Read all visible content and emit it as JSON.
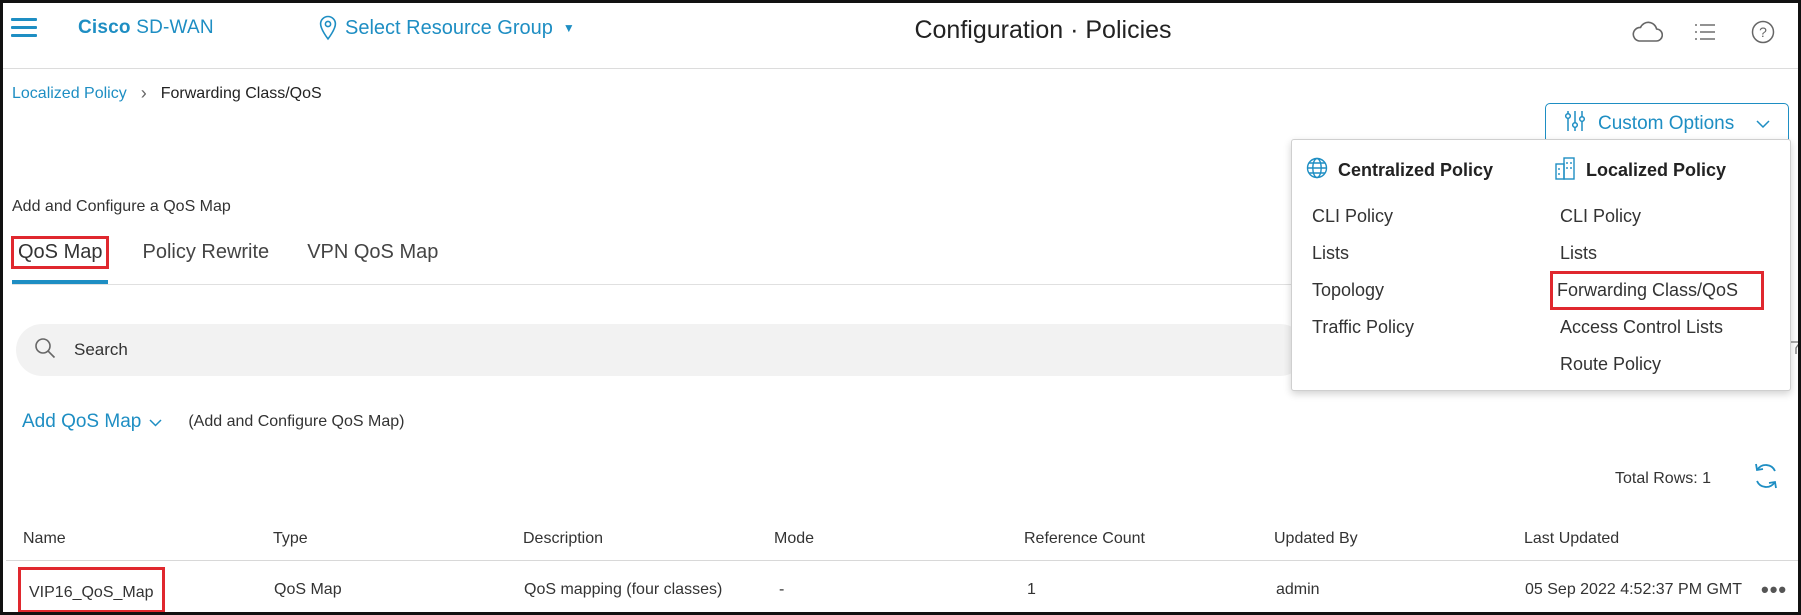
{
  "header": {
    "brand_bold": "Cisco",
    "brand_rest": " SD-WAN",
    "resource_group": "Select Resource Group",
    "title": "Configuration · Policies",
    "icons": [
      "hamburger-icon",
      "location-pin-icon",
      "cloud-icon",
      "task-list-icon",
      "help-icon"
    ]
  },
  "breadcrumb": {
    "parent": "Localized Policy",
    "current": "Forwarding Class/QoS"
  },
  "custom_options": {
    "label": "Custom Options",
    "centralized": {
      "heading": "Centralized Policy",
      "items": [
        "CLI Policy",
        "Lists",
        "Topology",
        "Traffic Policy"
      ]
    },
    "localized": {
      "heading": "Localized Policy",
      "items": [
        "CLI Policy",
        "Lists",
        "Forwarding Class/QoS",
        "Access Control Lists",
        "Route Policy"
      ]
    }
  },
  "section_label": "Add and Configure a QoS Map",
  "tabs": [
    "QoS Map",
    "Policy Rewrite",
    "VPN QoS Map"
  ],
  "active_tab": "QoS Map",
  "search": {
    "placeholder": "Search"
  },
  "add": {
    "label": "Add QoS Map",
    "hint": "(Add and Configure QoS Map)"
  },
  "total_rows": "Total Rows: 1",
  "table": {
    "headers": [
      "Name",
      "Type",
      "Description",
      "Mode",
      "Reference Count",
      "Updated By",
      "Last Updated"
    ],
    "rows": [
      [
        "VIP16_QoS_Map",
        "QoS Map",
        "QoS mapping (four classes)",
        "-",
        "1",
        "admin",
        "05 Sep 2022 4:52:37 PM GMT"
      ]
    ]
  },
  "colors": {
    "accent": "#1e8ec3",
    "highlight": "#e0282e"
  }
}
